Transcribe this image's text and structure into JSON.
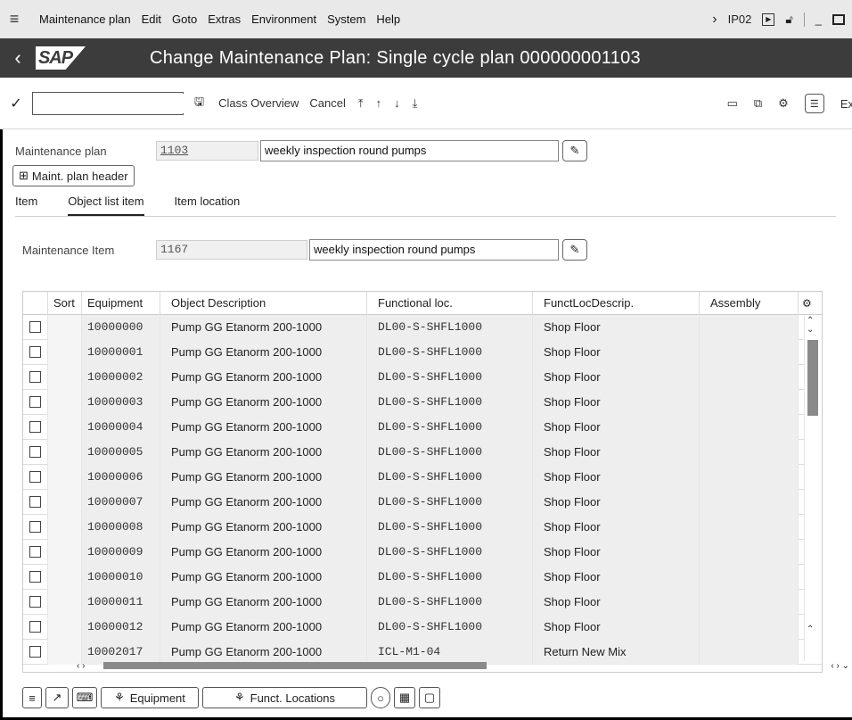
{
  "menubar": {
    "items": [
      "Maintenance plan",
      "Edit",
      "Goto",
      "Extras",
      "Environment",
      "System",
      "Help"
    ],
    "system_id": "IP02"
  },
  "titlebar": {
    "logo": "SAP",
    "title": "Change Maintenance Plan: Single cycle plan 000000001103"
  },
  "toolbar": {
    "command_value": "",
    "class_overview": "Class Overview",
    "cancel": "Cancel",
    "exit_partial": "Ex"
  },
  "header": {
    "plan_label": "Maintenance plan",
    "plan_number": "1103",
    "plan_text": "weekly inspection round pumps",
    "plan_header_button": "Maint. plan header"
  },
  "tabs": [
    {
      "label": "Item",
      "active": false
    },
    {
      "label": "Object list item",
      "active": true
    },
    {
      "label": "Item location",
      "active": false
    }
  ],
  "item": {
    "label": "Maintenance Item",
    "number": "1167",
    "text": "weekly inspection round pumps"
  },
  "table": {
    "columns": [
      "Sort",
      "Equipment",
      "Object Description",
      "Functional loc.",
      "FunctLocDescrip.",
      "Assembly"
    ],
    "rows": [
      {
        "equipment": "10000000",
        "description": "Pump GG Etanorm 200-1000",
        "floc": "DL00-S-SHFL1000",
        "floc_desc": "Shop Floor",
        "assembly": ""
      },
      {
        "equipment": "10000001",
        "description": "Pump GG Etanorm 200-1000",
        "floc": "DL00-S-SHFL1000",
        "floc_desc": "Shop Floor",
        "assembly": ""
      },
      {
        "equipment": "10000002",
        "description": "Pump GG Etanorm 200-1000",
        "floc": "DL00-S-SHFL1000",
        "floc_desc": "Shop Floor",
        "assembly": ""
      },
      {
        "equipment": "10000003",
        "description": "Pump GG Etanorm 200-1000",
        "floc": "DL00-S-SHFL1000",
        "floc_desc": "Shop Floor",
        "assembly": ""
      },
      {
        "equipment": "10000004",
        "description": "Pump GG Etanorm 200-1000",
        "floc": "DL00-S-SHFL1000",
        "floc_desc": "Shop Floor",
        "assembly": ""
      },
      {
        "equipment": "10000005",
        "description": "Pump GG Etanorm 200-1000",
        "floc": "DL00-S-SHFL1000",
        "floc_desc": "Shop Floor",
        "assembly": ""
      },
      {
        "equipment": "10000006",
        "description": "Pump GG Etanorm 200-1000",
        "floc": "DL00-S-SHFL1000",
        "floc_desc": "Shop Floor",
        "assembly": ""
      },
      {
        "equipment": "10000007",
        "description": "Pump GG Etanorm 200-1000",
        "floc": "DL00-S-SHFL1000",
        "floc_desc": "Shop Floor",
        "assembly": ""
      },
      {
        "equipment": "10000008",
        "description": "Pump GG Etanorm 200-1000",
        "floc": "DL00-S-SHFL1000",
        "floc_desc": "Shop Floor",
        "assembly": ""
      },
      {
        "equipment": "10000009",
        "description": "Pump GG Etanorm 200-1000",
        "floc": "DL00-S-SHFL1000",
        "floc_desc": "Shop Floor",
        "assembly": ""
      },
      {
        "equipment": "10000010",
        "description": "Pump GG Etanorm 200-1000",
        "floc": "DL00-S-SHFL1000",
        "floc_desc": "Shop Floor",
        "assembly": ""
      },
      {
        "equipment": "10000011",
        "description": "Pump GG Etanorm 200-1000",
        "floc": "DL00-S-SHFL1000",
        "floc_desc": "Shop Floor",
        "assembly": ""
      },
      {
        "equipment": "10000012",
        "description": "Pump GG Etanorm 200-1000",
        "floc": "DL00-S-SHFL1000",
        "floc_desc": "Shop Floor",
        "assembly": ""
      },
      {
        "equipment": "10002017",
        "description": "Pump GG Etanorm 200-1000",
        "floc": "ICL-M1-04",
        "floc_desc": "Return New Mix",
        "assembly": ""
      }
    ]
  },
  "bottom_toolbar": {
    "equipment_button": "Equipment",
    "funct_locations_button": "Funct. Locations"
  },
  "colors": {
    "titlebar_bg": "#3c3c3c",
    "menubar_bg": "#e9e9e9",
    "readonly_cell_bg": "#eeeeee"
  }
}
